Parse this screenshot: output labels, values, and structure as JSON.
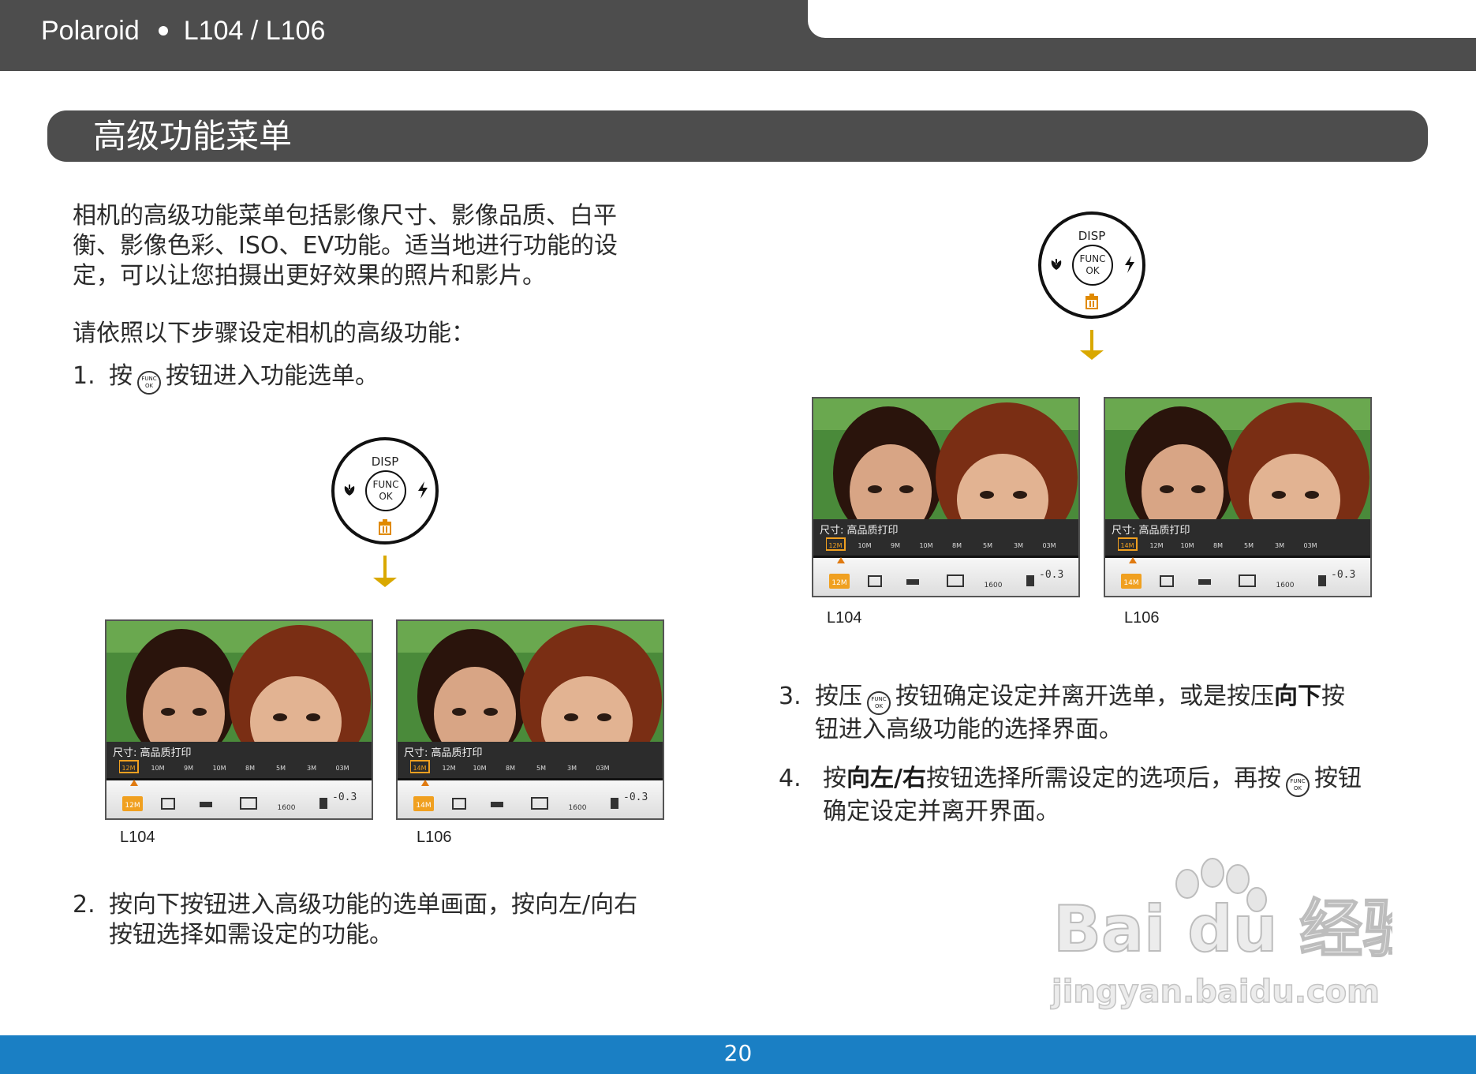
{
  "header": {
    "brand": "Polaroid",
    "model": "L104 / L106"
  },
  "section": {
    "title": "高级功能菜单"
  },
  "intro": {
    "lines": [
      "相机的高级功能菜单包括影像尺寸、影像品质、白平",
      "衡、影像色彩、ISO、EV功能。适当地进行功能的设",
      "定，可以让您拍摄出更好效果的照片和影片。"
    ],
    "prompt": "请依照以下步骤设定相机的高级功能："
  },
  "steps": {
    "s1": {
      "num": "1.",
      "pre": "按",
      "post": "按钮进入功能选单。"
    },
    "s2": {
      "num": "2.",
      "line1": "按向下按钮进入高级功能的选单画面，按向左/向右",
      "line2": "按钮选择如需设定的功能。"
    },
    "s3": {
      "num": "3.",
      "pre": "按压",
      "mid": "按钮确定设定并离开选单，或是按压",
      "bold": "向下",
      "post": "按",
      "line2": "钮进入高级功能的选择界面。"
    },
    "s4": {
      "num": "4.",
      "pre": "按",
      "bold": "向左/右",
      "mid": "按钮选择所需设定的选项后，再按",
      "post": "按钮",
      "line2": "确定设定并离开界面。"
    }
  },
  "dial": {
    "top": "DISP",
    "center_line1": "FUNC",
    "center_line2": "OK",
    "icons": [
      "macro-icon",
      "flash-icon",
      "trash-icon"
    ]
  },
  "func_icon": {
    "line1": "FUNC",
    "line2": "OK"
  },
  "screen": {
    "bar_label": "尺寸: 高品质打印",
    "ev": "-0.3",
    "iso": "1600",
    "l104_options": [
      "12M",
      "10M",
      "9M",
      "10M",
      "8M",
      "5M",
      "3M",
      "03M"
    ],
    "l106_options": [
      "14M",
      "12M",
      "10M",
      "8M",
      "5M",
      "3M",
      "03M"
    ],
    "l104_selected": "12M",
    "l106_selected": "14M"
  },
  "labels": {
    "l104": "L104",
    "l106": "L106"
  },
  "footer": {
    "page": "20"
  },
  "watermark": {
    "logo": "Bai du 经验",
    "url": "jingyan.baidu.com"
  },
  "colors": {
    "header": "#4d4d4d",
    "footer": "#1a7fc4",
    "accent": "#d9a800"
  }
}
